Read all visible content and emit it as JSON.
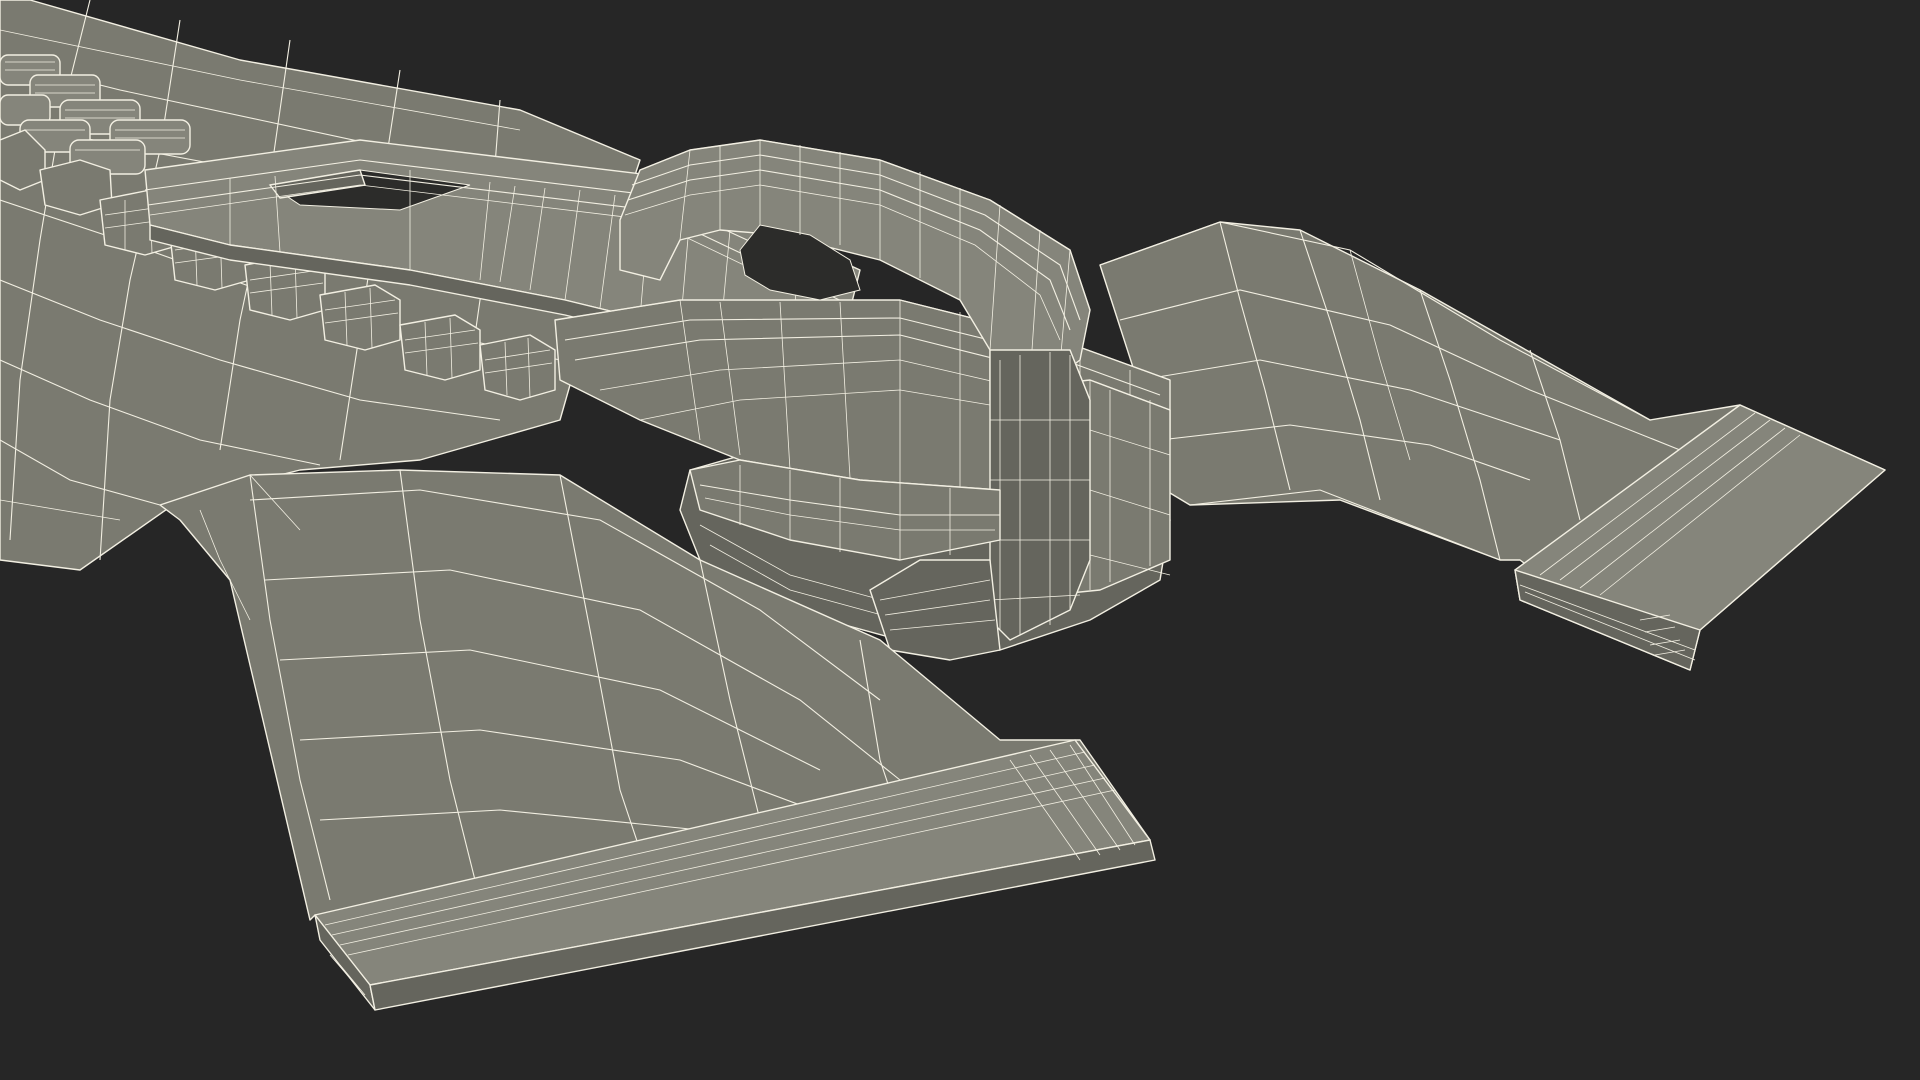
{
  "scene": {
    "subject": "zipper-wireframe-model",
    "view": "perspective",
    "background_color": "#262626",
    "surface_color": "#7a7a70",
    "surface_color_shadow": "#5e5e56",
    "surface_color_light": "#8a8a80",
    "wire_color": "#f2efe2",
    "wireframe": true
  }
}
